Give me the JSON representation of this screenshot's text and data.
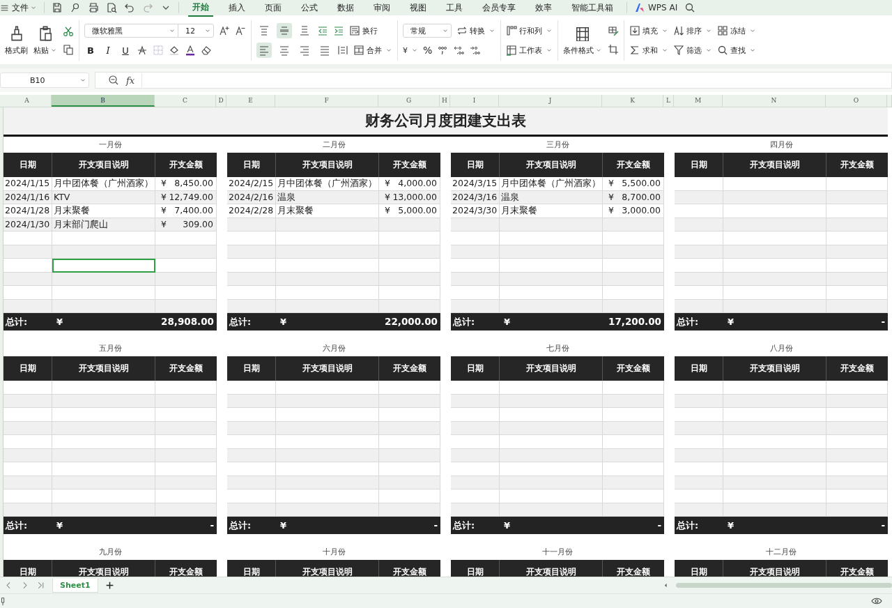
{
  "menu": {
    "file": "文件",
    "tabs": [
      {
        "label": "开始",
        "selected": true
      },
      {
        "label": "插入",
        "selected": false
      },
      {
        "label": "页面",
        "selected": false
      },
      {
        "label": "公式",
        "selected": false
      },
      {
        "label": "数据",
        "selected": false
      },
      {
        "label": "审阅",
        "selected": false
      },
      {
        "label": "视图",
        "selected": false
      },
      {
        "label": "工具",
        "selected": false
      },
      {
        "label": "会员专享",
        "selected": false
      },
      {
        "label": "效率",
        "selected": false
      },
      {
        "label": "智能工具箱",
        "selected": false
      }
    ],
    "ai": "WPS AI"
  },
  "ribbon": {
    "format_painter": "格式刷",
    "paste": "粘贴",
    "font": "微软雅黑",
    "size": "12",
    "bold": "B",
    "italic": "I",
    "underline": "U",
    "wrap": "换行",
    "merge": "合并",
    "number_format": "常规",
    "convert": "转换",
    "currency": "¥",
    "percent": "%",
    "rows_cols": "行和列",
    "worksheet": "工作表",
    "conditional": "条件格式",
    "fill": "填充",
    "sort": "排序",
    "freeze": "冻结",
    "sum": "求和",
    "filter": "筛选",
    "find": "查找",
    "vertical_align": [
      {
        "selected": false
      },
      {
        "selected": true
      },
      {
        "selected": false
      }
    ],
    "horizontal_align": [
      {
        "selected": true
      },
      {
        "selected": false
      },
      {
        "selected": false
      },
      {
        "selected": false
      }
    ]
  },
  "formula_bar": {
    "cell": "B10",
    "fx": "fx"
  },
  "columns": [
    {
      "label": "A",
      "selected": false
    },
    {
      "label": "B",
      "selected": true
    },
    {
      "label": "C",
      "selected": false
    },
    {
      "label": "D",
      "selected": false
    },
    {
      "label": "E",
      "selected": false
    },
    {
      "label": "F",
      "selected": false
    },
    {
      "label": "G",
      "selected": false
    },
    {
      "label": "H",
      "selected": false
    },
    {
      "label": "I",
      "selected": false
    },
    {
      "label": "J",
      "selected": false
    },
    {
      "label": "K",
      "selected": false
    },
    {
      "label": "L",
      "selected": false
    },
    {
      "label": "M",
      "selected": false
    },
    {
      "label": "N",
      "selected": false
    },
    {
      "label": "O",
      "selected": false
    }
  ],
  "title": "财务公司月度团建支出表",
  "months": [
    {
      "label": "一月份",
      "headers": [
        "日期",
        "开支项目说明",
        "开支金额"
      ],
      "rows": [
        {
          "date": "2024/1/15",
          "item": "月中团体餐（广州酒家）",
          "currency": "¥",
          "amount": "8,450.00",
          "selected": false
        },
        {
          "date": "2024/1/16",
          "item": "KTV",
          "currency": "¥",
          "amount": "12,749.00",
          "selected": false
        },
        {
          "date": "2024/1/28",
          "item": "月末聚餐",
          "currency": "¥",
          "amount": "7,400.00",
          "selected": false
        },
        {
          "date": "2024/1/30",
          "item": "月末部门爬山",
          "currency": "¥",
          "amount": "309.00",
          "selected": false
        },
        {
          "selected": false
        },
        {
          "selected": false
        },
        {
          "selected": true
        },
        {
          "selected": false
        },
        {
          "selected": false
        },
        {
          "selected": false
        }
      ],
      "total_label": "总计:",
      "total_currency": "¥",
      "total": "28,908.00"
    },
    {
      "label": "二月份",
      "headers": [
        "日期",
        "开支项目说明",
        "开支金额"
      ],
      "rows": [
        {
          "date": "2024/2/15",
          "item": "月中团体餐（广州酒家）",
          "currency": "¥",
          "amount": "4,000.00",
          "selected": false
        },
        {
          "date": "2024/2/16",
          "item": "温泉",
          "currency": "¥",
          "amount": "13,000.00",
          "selected": false
        },
        {
          "date": "2024/2/28",
          "item": "月末聚餐",
          "currency": "¥",
          "amount": "5,000.00",
          "selected": false
        },
        {
          "selected": false
        },
        {
          "selected": false
        },
        {
          "selected": false
        },
        {
          "selected": false
        },
        {
          "selected": false
        },
        {
          "selected": false
        },
        {
          "selected": false
        }
      ],
      "total_label": "总计:",
      "total_currency": "¥",
      "total": "22,000.00"
    },
    {
      "label": "三月份",
      "headers": [
        "日期",
        "开支项目说明",
        "开支金额"
      ],
      "rows": [
        {
          "date": "2024/3/15",
          "item": "月中团体餐（广州酒家）",
          "currency": "¥",
          "amount": "5,500.00",
          "selected": false
        },
        {
          "date": "2024/3/16",
          "item": "温泉",
          "currency": "¥",
          "amount": "8,700.00",
          "selected": false
        },
        {
          "date": "2024/3/30",
          "item": "月末聚餐",
          "currency": "¥",
          "amount": "3,000.00",
          "selected": false
        },
        {
          "selected": false
        },
        {
          "selected": false
        },
        {
          "selected": false
        },
        {
          "selected": false
        },
        {
          "selected": false
        },
        {
          "selected": false
        },
        {
          "selected": false
        }
      ],
      "total_label": "总计:",
      "total_currency": "¥",
      "total": "17,200.00"
    },
    {
      "label": "四月份",
      "headers": [
        "日期",
        "开支项目说明",
        "开支金额"
      ],
      "rows": [
        {
          "selected": false
        },
        {
          "selected": false
        },
        {
          "selected": false
        },
        {
          "selected": false
        },
        {
          "selected": false
        },
        {
          "selected": false
        },
        {
          "selected": false
        },
        {
          "selected": false
        },
        {
          "selected": false
        },
        {
          "selected": false
        }
      ],
      "total_label": "总计:",
      "total_currency": "¥",
      "total": "-"
    },
    {
      "label": "五月份",
      "headers": [
        "日期",
        "开支项目说明",
        "开支金额"
      ],
      "rows": [
        {
          "selected": false
        },
        {
          "selected": false
        },
        {
          "selected": false
        },
        {
          "selected": false
        },
        {
          "selected": false
        },
        {
          "selected": false
        },
        {
          "selected": false
        },
        {
          "selected": false
        },
        {
          "selected": false
        },
        {
          "selected": false
        }
      ],
      "total_label": "总计:",
      "total_currency": "¥",
      "total": "-"
    },
    {
      "label": "六月份",
      "headers": [
        "日期",
        "开支项目说明",
        "开支金额"
      ],
      "rows": [
        {
          "selected": false
        },
        {
          "selected": false
        },
        {
          "selected": false
        },
        {
          "selected": false
        },
        {
          "selected": false
        },
        {
          "selected": false
        },
        {
          "selected": false
        },
        {
          "selected": false
        },
        {
          "selected": false
        },
        {
          "selected": false
        }
      ],
      "total_label": "总计:",
      "total_currency": "¥",
      "total": "-"
    },
    {
      "label": "七月份",
      "headers": [
        "日期",
        "开支项目说明",
        "开支金额"
      ],
      "rows": [
        {
          "selected": false
        },
        {
          "selected": false
        },
        {
          "selected": false
        },
        {
          "selected": false
        },
        {
          "selected": false
        },
        {
          "selected": false
        },
        {
          "selected": false
        },
        {
          "selected": false
        },
        {
          "selected": false
        },
        {
          "selected": false
        }
      ],
      "total_label": "总计:",
      "total_currency": "¥",
      "total": "-"
    },
    {
      "label": "八月份",
      "headers": [
        "日期",
        "开支项目说明",
        "开支金额"
      ],
      "rows": [
        {
          "selected": false
        },
        {
          "selected": false
        },
        {
          "selected": false
        },
        {
          "selected": false
        },
        {
          "selected": false
        },
        {
          "selected": false
        },
        {
          "selected": false
        },
        {
          "selected": false
        },
        {
          "selected": false
        },
        {
          "selected": false
        }
      ],
      "total_label": "总计:",
      "total_currency": "¥",
      "total": "-"
    },
    {
      "label": "九月份",
      "headers": [
        "日期",
        "开支项目说明",
        "开支金额"
      ]
    },
    {
      "label": "十月份",
      "headers": [
        "日期",
        "开支项目说明",
        "开支金额"
      ]
    },
    {
      "label": "十一月份",
      "headers": [
        "日期",
        "开支项目说明",
        "开支金额"
      ]
    },
    {
      "label": "十二月份",
      "headers": [
        "日期",
        "开支项目说明",
        "开支金额"
      ]
    }
  ],
  "sheet_tabs": [
    {
      "label": "Sheet1",
      "selected": true
    }
  ]
}
